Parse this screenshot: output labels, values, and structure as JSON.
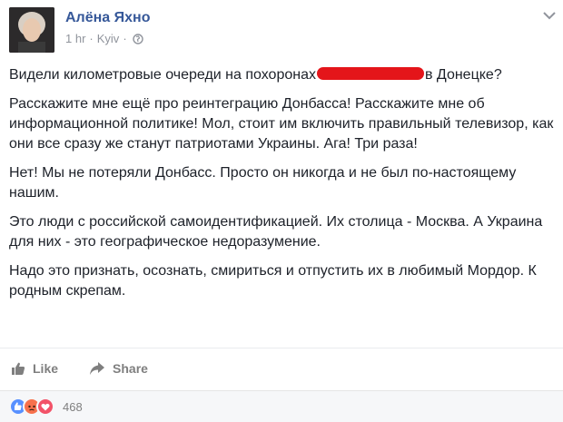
{
  "post": {
    "author": "Алёна Яхно",
    "time": "1 hr",
    "location": "Kyiv",
    "separator": "·",
    "paragraphs": {
      "p1_before": "Видели километровые очереди на похоронах",
      "p1_after": "в Донецке?",
      "p2": "Расскажите мне ещё про реинтеграцию Донбасса! Расскажите мне об информационной политике! Мол, стоит им включить правильный телевизор, как они все сразу же станут патриотами Украины. Ага! Три раза!",
      "p3": "Нет! Мы не потеряли Донбасс. Просто он никогда и не был по-настоящему нашим.",
      "p4": "Это люди с российской самоидентификацией. Их столица - Москва. А Украина для них - это географическое недоразумение.",
      "p5": "Надо это признать, осознать, смириться и отпустить их в любимый Мордор. К родным скрепам."
    },
    "redaction_color": "#e4151a"
  },
  "actions": {
    "like_label": "Like",
    "share_label": "Share"
  },
  "reactions": {
    "types": [
      "like",
      "angry",
      "love"
    ],
    "count": "468"
  },
  "colors": {
    "name": "#365899",
    "meta": "#90949c",
    "text": "#1d2129",
    "action": "#7f7f7f"
  },
  "icons": [
    "globe-icon",
    "chevron-down-icon",
    "like-thumb-icon",
    "share-arrow-icon"
  ]
}
